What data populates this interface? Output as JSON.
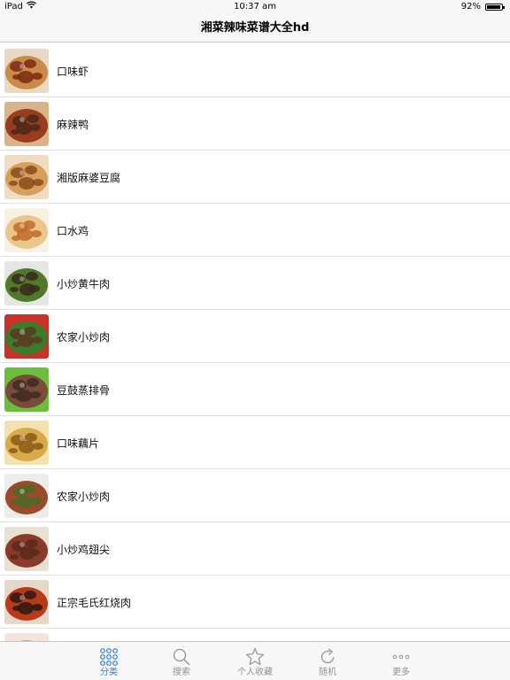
{
  "status_bar": {
    "device": "iPad",
    "time": "10:37 am",
    "battery": "92%",
    "battery_level": 0.92
  },
  "nav": {
    "title": "湘菜辣味菜谱大全hd"
  },
  "list": {
    "items": [
      {
        "label": "口味虾",
        "thumb_colors": [
          "#7a2a12",
          "#c98a4a",
          "#e8d9c4"
        ]
      },
      {
        "label": "麻辣鸭",
        "thumb_colors": [
          "#4a2a18",
          "#9b3b1f",
          "#d9b48a"
        ]
      },
      {
        "label": "湘版麻婆豆腐",
        "thumb_colors": [
          "#8a4a1a",
          "#d6a05a",
          "#f0dcc0"
        ]
      },
      {
        "label": "口水鸡",
        "thumb_colors": [
          "#c26a2a",
          "#e9c68a",
          "#f7f0e4"
        ]
      },
      {
        "label": "小炒黄牛肉",
        "thumb_colors": [
          "#3a2a1a",
          "#4e7a2a",
          "#e6e6e6"
        ]
      },
      {
        "label": "农家小炒肉",
        "thumb_colors": [
          "#5a3a22",
          "#3d7a2a",
          "#c8322a"
        ]
      },
      {
        "label": "豆鼓蒸排骨",
        "thumb_colors": [
          "#3e2a22",
          "#7a4a3a",
          "#6bbf3a"
        ]
      },
      {
        "label": "口味藕片",
        "thumb_colors": [
          "#8a5a1a",
          "#d9a94a",
          "#f2e2b0"
        ]
      },
      {
        "label": "农家小炒肉",
        "thumb_colors": [
          "#4a6a2a",
          "#9b4a2a",
          "#ececec"
        ]
      },
      {
        "label": "小炒鸡翅尖",
        "thumb_colors": [
          "#5a2a1a",
          "#8a3a2a",
          "#e8e0d0"
        ]
      },
      {
        "label": "正宗毛氏红烧肉",
        "thumb_colors": [
          "#2a1a14",
          "#b83a1a",
          "#e6d8c8"
        ]
      },
      {
        "label": "",
        "thumb_colors": [
          "#c84a2a",
          "#e89070",
          "#f4e4dc"
        ]
      }
    ]
  },
  "tab_bar": {
    "tabs": [
      {
        "label": "分类",
        "icon": "grid-icon",
        "active": true
      },
      {
        "label": "搜索",
        "icon": "search-icon",
        "active": false
      },
      {
        "label": "个人收藏",
        "icon": "star-icon",
        "active": false
      },
      {
        "label": "随机",
        "icon": "refresh-icon",
        "active": false
      },
      {
        "label": "更多",
        "icon": "more-icon",
        "active": false
      }
    ],
    "active_color": "#2a7de1",
    "inactive_color": "#929292"
  }
}
